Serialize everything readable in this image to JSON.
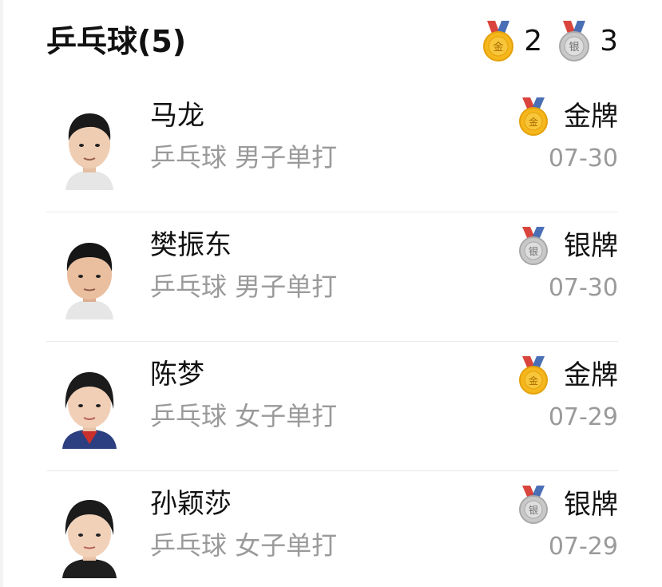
{
  "header": {
    "title": "乒乓球(5)",
    "gold_icon": "gold-medal-icon",
    "gold_count": "2",
    "silver_icon": "silver-medal-icon",
    "silver_count": "3"
  },
  "medal_marks": {
    "gold": "金",
    "silver": "银"
  },
  "colors": {
    "gold": "#f5b71c",
    "silver": "#c8c8c8",
    "ribbon_red": "#d9453d",
    "ribbon_blue": "#4a6fb5",
    "secondary_text": "#9a9a9a",
    "divider": "#e8e8e8"
  },
  "rows": [
    {
      "name": "马龙",
      "event": "乒乓球 男子单打",
      "award": "金牌",
      "medal": "gold",
      "date": "07-30"
    },
    {
      "name": "樊振东",
      "event": "乒乓球 男子单打",
      "award": "银牌",
      "medal": "silver",
      "date": "07-30"
    },
    {
      "name": "陈梦",
      "event": "乒乓球 女子单打",
      "award": "金牌",
      "medal": "gold",
      "date": "07-29"
    },
    {
      "name": "孙颖莎",
      "event": "乒乓球 女子单打",
      "award": "银牌",
      "medal": "silver",
      "date": "07-29"
    }
  ]
}
